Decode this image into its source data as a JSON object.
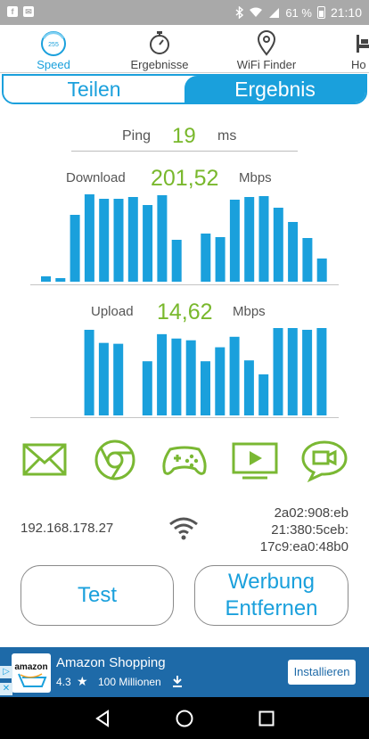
{
  "status_bar": {
    "left_icons": [
      "facebook-icon",
      "mail-icon"
    ],
    "battery_text": "61 %",
    "time": "21:10"
  },
  "nav": {
    "items": [
      {
        "label": "Speed",
        "icon": "speedometer-icon",
        "badge": "255"
      },
      {
        "label": "Ergebnisse",
        "icon": "stopwatch-icon"
      },
      {
        "label": "WiFi Finder",
        "icon": "map-pin-icon"
      },
      {
        "label": "Ho",
        "icon": "bed-icon"
      }
    ]
  },
  "segment": {
    "left_label": "Teilen",
    "right_label": "Ergebnis"
  },
  "ping": {
    "label": "Ping",
    "value": "19",
    "unit": "ms"
  },
  "download": {
    "label": "Download",
    "value": "201,52",
    "unit": "Mbps"
  },
  "upload": {
    "label": "Upload",
    "value": "14,62",
    "unit": "Mbps"
  },
  "chart_data": [
    {
      "type": "bar",
      "series": [
        {
          "values": [
            6,
            4,
            75,
            98,
            93,
            93,
            95,
            86,
            97,
            47,
            0,
            54,
            50,
            92,
            95,
            96,
            83,
            67,
            49,
            26
          ]
        }
      ],
      "ylim": [
        0,
        100
      ],
      "grid": false
    },
    {
      "type": "bar",
      "series": [
        {
          "values": [
            0,
            0,
            98,
            83,
            82,
            0,
            62,
            93,
            88,
            86,
            62,
            78,
            90,
            63,
            47,
            100,
            100,
            98,
            100
          ]
        }
      ],
      "ylim": [
        0,
        100
      ],
      "grid": false
    }
  ],
  "category_icons": [
    "email-icon",
    "browser-icon",
    "gamepad-icon",
    "video-player-icon",
    "video-chat-icon"
  ],
  "network": {
    "ipv4": "192.168.178.27",
    "ipv6_lines": [
      "2a02:908:eb",
      "21:380:5ceb:",
      "17c9:ea0:48b0"
    ],
    "wifi_icon": "wifi-icon"
  },
  "buttons": {
    "test_label": "Test",
    "remove_ads_line1": "Werbung",
    "remove_ads_line2": "Entfernen"
  },
  "ad": {
    "logo_text": "amazon",
    "title": "Amazon Shopping",
    "rating": "4.3",
    "downloads": "100 Millionen",
    "install_label": "Installieren"
  },
  "colors": {
    "accent_blue": "#1aa0dc",
    "value_green": "#79b82c",
    "icon_green": "#7ab833",
    "ad_blue": "#1e6aa8"
  }
}
